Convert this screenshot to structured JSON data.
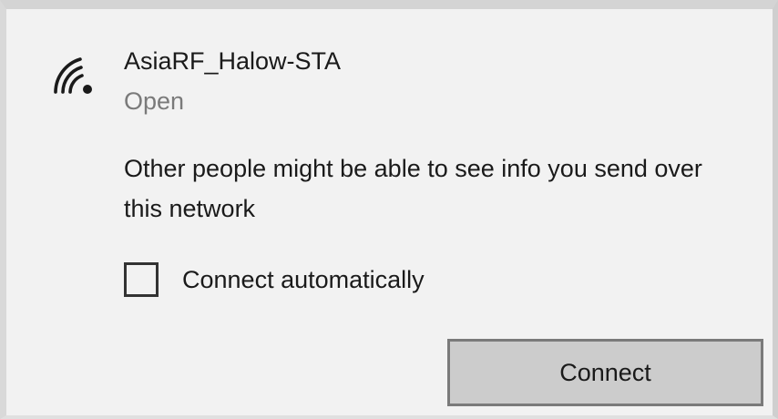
{
  "network": {
    "icon": "wifi-signal-icon",
    "name": "AsiaRF_Halow-STA",
    "status": "Open"
  },
  "warning_text": "Other people might be able to see info you send over this network",
  "connect_automatically": {
    "label": "Connect automatically",
    "checked": false
  },
  "buttons": {
    "connect_label": "Connect"
  },
  "colors": {
    "panel_background": "#f2f2f2",
    "button_background": "#cccccc",
    "button_border": "#7a7a7a",
    "secondary_text": "#7a7a7a",
    "primary_text": "#1a1a1a"
  }
}
